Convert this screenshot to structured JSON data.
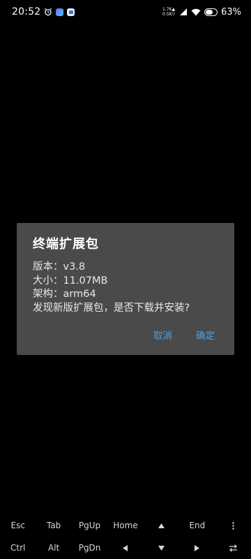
{
  "status_bar": {
    "time": "20:52",
    "net_up": "1.7K▲",
    "net_down": "0.5K▽",
    "battery": "63%"
  },
  "dialog": {
    "title": "终端扩展包",
    "version_line": "版本：v3.8",
    "size_line": "大小：11.07MB",
    "arch_line": "架构：arm64",
    "message": "发现新版扩展包，是否下载并安装?",
    "cancel_label": "取消",
    "confirm_label": "确定",
    "accent_color": "#4fa0e0"
  },
  "extra_keys": {
    "row1": {
      "esc": "Esc",
      "tab": "Tab",
      "pgup": "PgUp",
      "home": "Home",
      "end": "End"
    },
    "row2": {
      "ctrl": "Ctrl",
      "alt": "Alt",
      "pgdn": "PgDn"
    },
    "icons": [
      "arrow-up-icon",
      "more-vertical-icon",
      "arrow-left-icon",
      "arrow-down-icon",
      "arrow-right-icon",
      "swap-icon"
    ]
  }
}
